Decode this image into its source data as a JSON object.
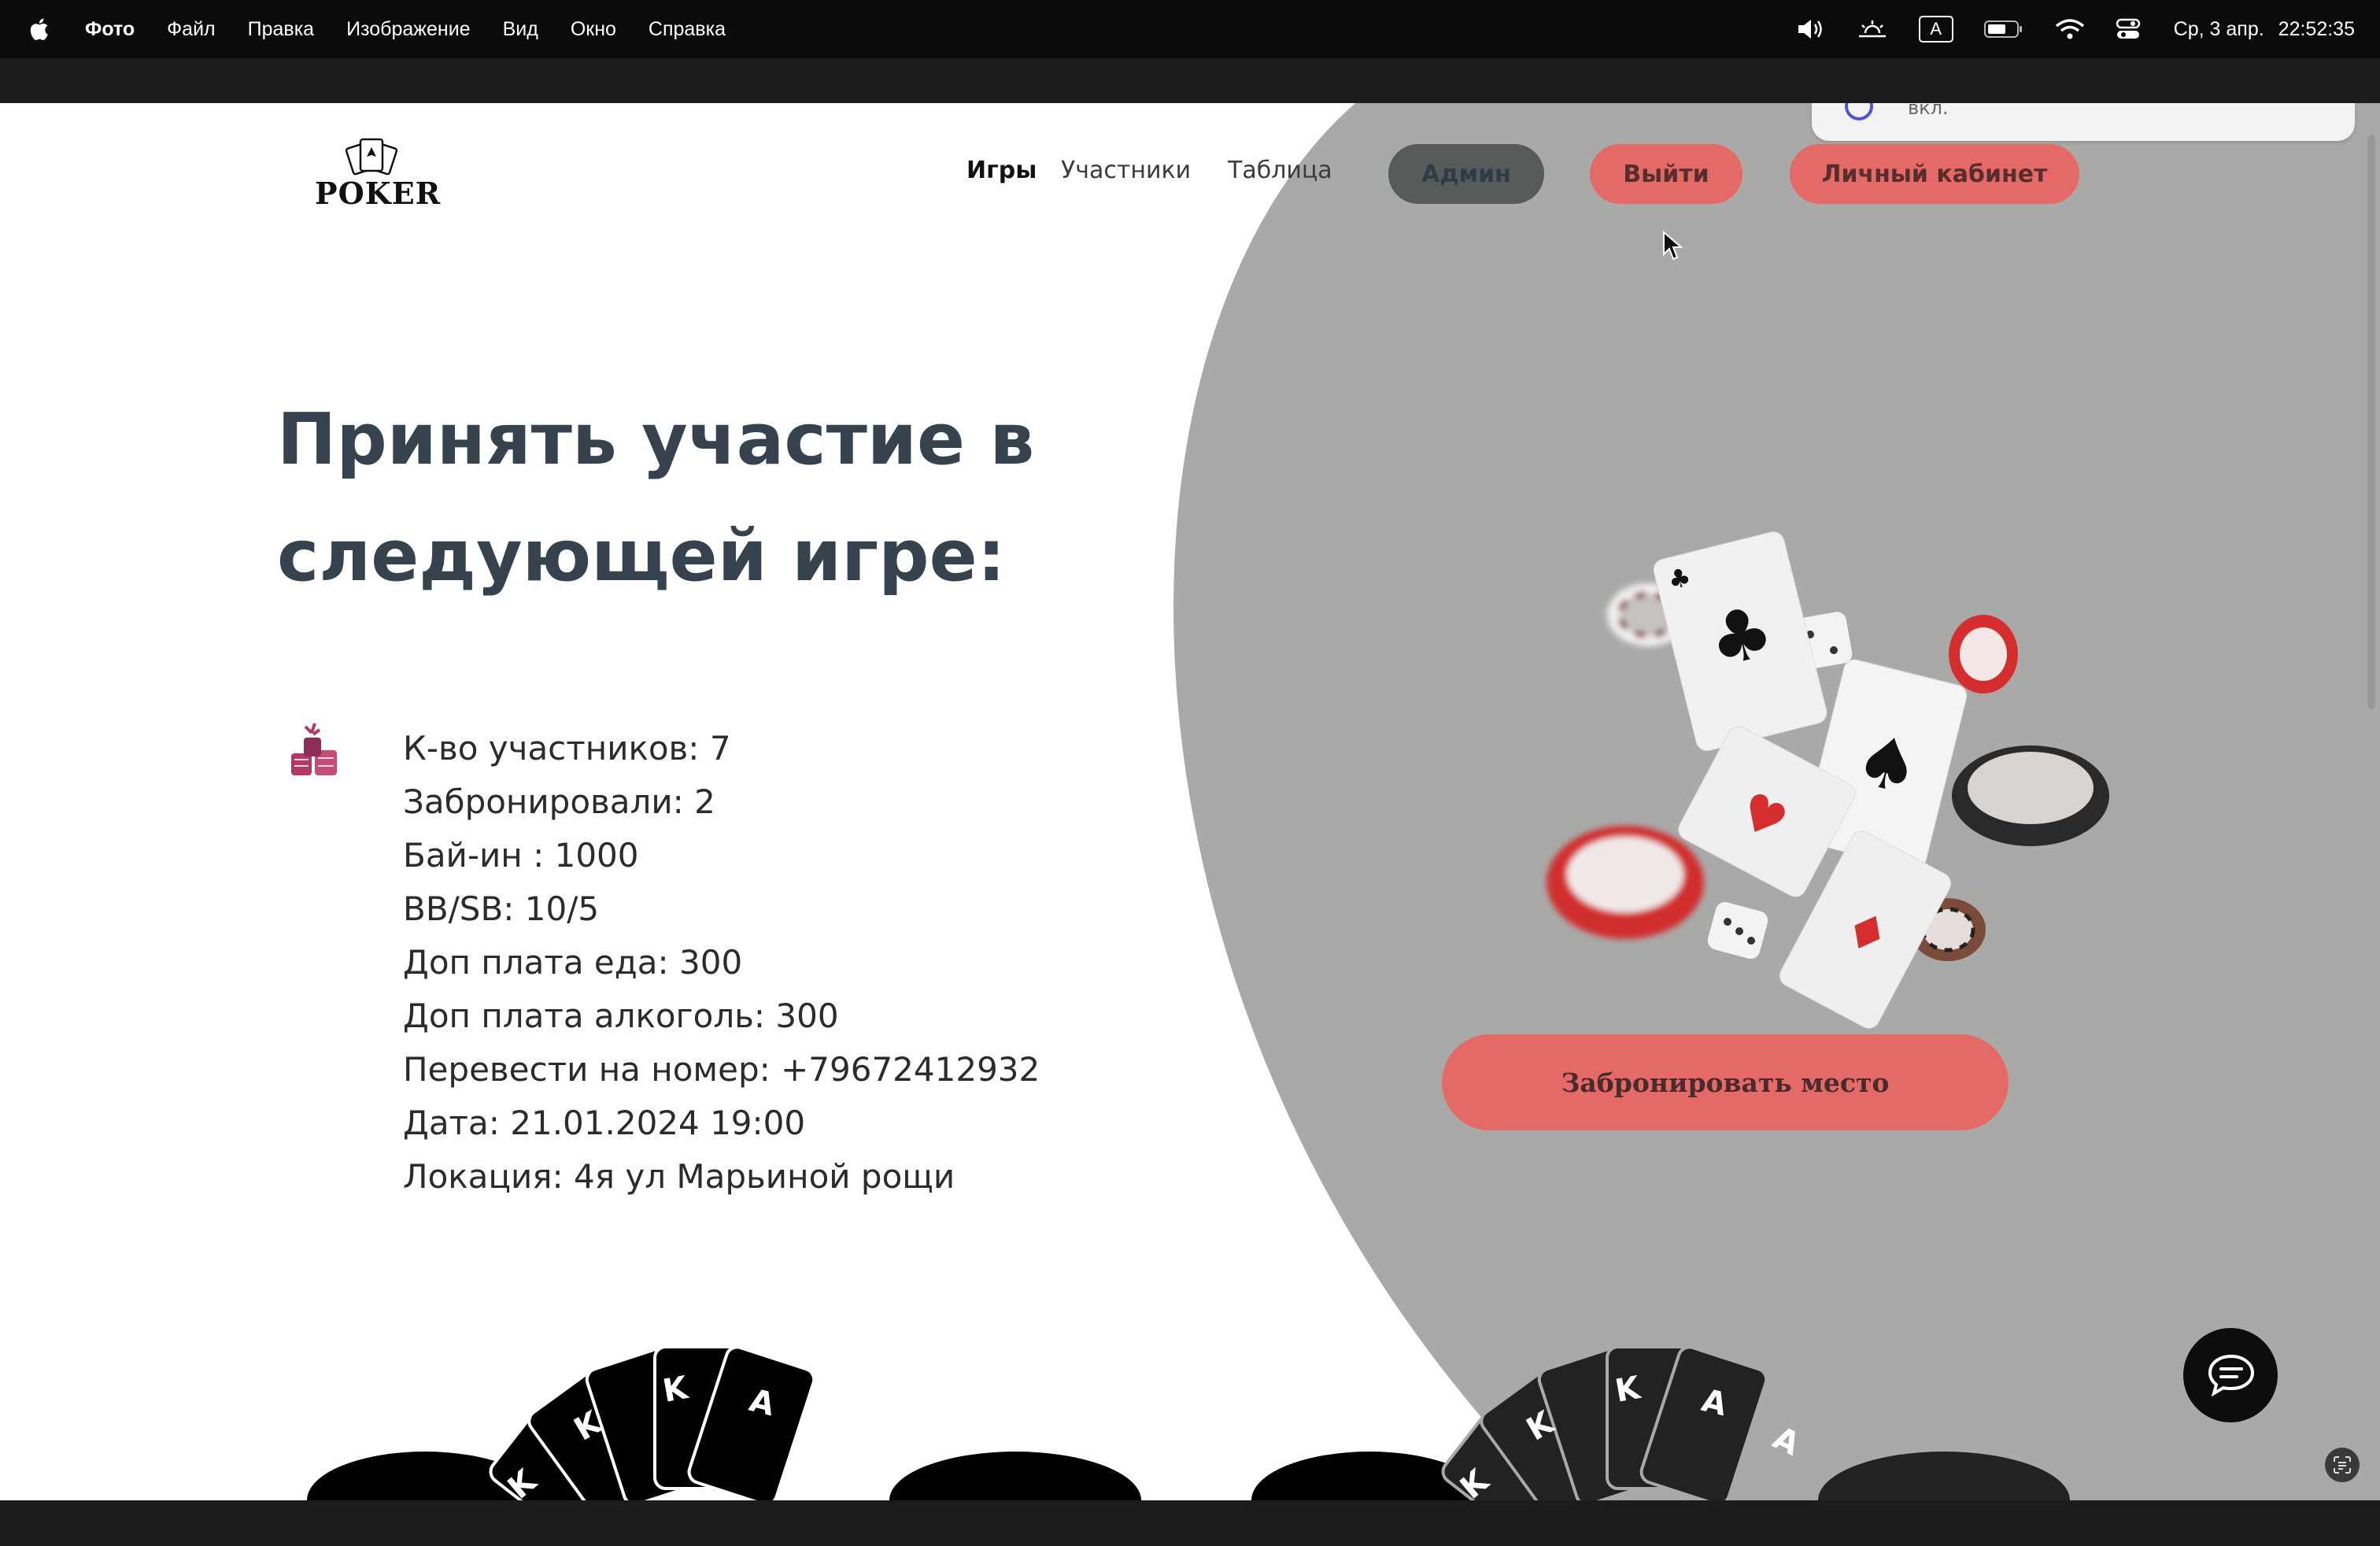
{
  "menubar": {
    "app_name": "Фото",
    "menu_items": [
      "Файл",
      "Правка",
      "Изображение",
      "Вид",
      "Окно",
      "Справка"
    ],
    "input_indicator": "A",
    "clock_date": "Ср, 3 апр.",
    "clock_time": "22:52:35"
  },
  "notification": {
    "text": "вкл."
  },
  "site": {
    "logo_text": "POKER",
    "nav": {
      "games": "Игры",
      "participants": "Участники",
      "table": "Таблица"
    },
    "buttons": {
      "admin": "Админ",
      "logout": "Выйти",
      "cabinet": "Личный кабинет"
    }
  },
  "hero": {
    "title": "Принять участие в следующей игре:",
    "details": [
      "К-во участников: 7",
      "Забронировали: 2",
      "Бай-ин : 1000",
      "BB/SB: 10/5",
      "Доп плата еда: 300",
      "Доп плата алкоголь: 300",
      "Перевести на номер: +79672412932",
      "Дата: 21.01.2024 19:00",
      "Локация: 4я ул Марьиной рощи"
    ],
    "book_button": "Забронировать место"
  },
  "decor": {
    "card_letters": [
      "K",
      "K",
      "K",
      "A",
      "A"
    ]
  },
  "colors": {
    "accent": "#e46a67",
    "admin_button": "#565a58",
    "grey_panel": "#a9aaa8",
    "heading": "#37424f"
  },
  "icons": [
    "apple-icon",
    "volume-icon",
    "brightness-icon",
    "battery-icon",
    "wifi-icon",
    "control-center-icon",
    "chat-icon",
    "scan-text-icon",
    "poker-chips-icon",
    "cursor-icon"
  ]
}
